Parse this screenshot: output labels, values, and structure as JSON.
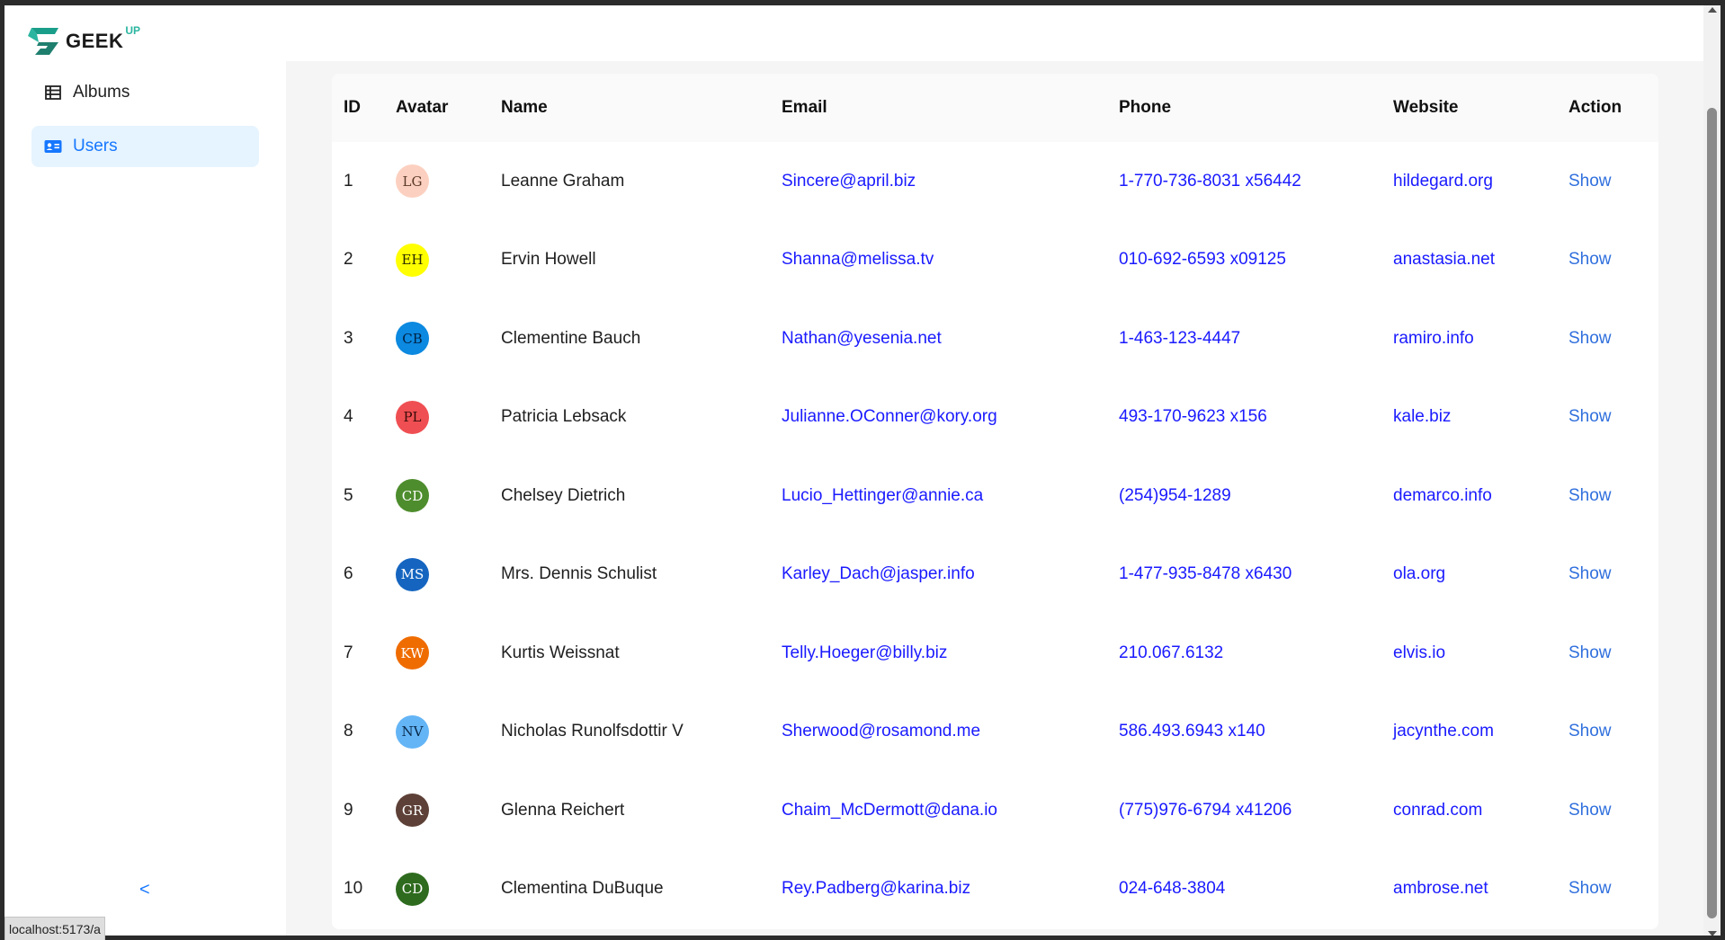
{
  "app": {
    "logo_text": "GEEK",
    "logo_sup": "UP"
  },
  "sidebar": {
    "items": [
      {
        "label": "Albums",
        "icon": "table-icon"
      },
      {
        "label": "Users",
        "icon": "id-card-icon"
      }
    ],
    "collapse_label": "<"
  },
  "table": {
    "headers": [
      "ID",
      "Avatar",
      "Name",
      "Email",
      "Phone",
      "Website",
      "Action"
    ],
    "rows": [
      {
        "id": "1",
        "initials": "LG",
        "avatar_color": "#fcd0c0",
        "avatar_text_color": "#5a3a2a",
        "name": "Leanne Graham",
        "email": "Sincere@april.biz",
        "phone": "1-770-736-8031 x56442",
        "website": "hildegard.org",
        "action": "Show"
      },
      {
        "id": "2",
        "initials": "EH",
        "avatar_color": "#ffff00",
        "avatar_text_color": "#2a2a00",
        "name": "Ervin Howell",
        "email": "Shanna@melissa.tv",
        "phone": "010-692-6593 x09125",
        "website": "anastasia.net",
        "action": "Show"
      },
      {
        "id": "3",
        "initials": "CB",
        "avatar_color": "#0c89e0",
        "avatar_text_color": "#002244",
        "name": "Clementine Bauch",
        "email": "Nathan@yesenia.net",
        "phone": "1-463-123-4447",
        "website": "ramiro.info",
        "action": "Show"
      },
      {
        "id": "4",
        "initials": "PL",
        "avatar_color": "#ef4f52",
        "avatar_text_color": "#3a0a0a",
        "name": "Patricia Lebsack",
        "email": "Julianne.OConner@kory.org",
        "phone": "493-170-9623 x156",
        "website": "kale.biz",
        "action": "Show"
      },
      {
        "id": "5",
        "initials": "CD",
        "avatar_color": "#4e8d2d",
        "avatar_text_color": "#ffffff",
        "name": "Chelsey Dietrich",
        "email": "Lucio_Hettinger@annie.ca",
        "phone": "(254)954-1289",
        "website": "demarco.info",
        "action": "Show"
      },
      {
        "id": "6",
        "initials": "MS",
        "avatar_color": "#1565c0",
        "avatar_text_color": "#ffffff",
        "name": "Mrs. Dennis Schulist",
        "email": "Karley_Dach@jasper.info",
        "phone": "1-477-935-8478 x6430",
        "website": "ola.org",
        "action": "Show"
      },
      {
        "id": "7",
        "initials": "KW",
        "avatar_color": "#ef6c00",
        "avatar_text_color": "#ffffff",
        "name": "Kurtis Weissnat",
        "email": "Telly.Hoeger@billy.biz",
        "phone": "210.067.6132",
        "website": "elvis.io",
        "action": "Show"
      },
      {
        "id": "8",
        "initials": "NV",
        "avatar_color": "#64b5f6",
        "avatar_text_color": "#0a2a4a",
        "name": "Nicholas Runolfsdottir V",
        "email": "Sherwood@rosamond.me",
        "phone": "586.493.6943 x140",
        "website": "jacynthe.com",
        "action": "Show"
      },
      {
        "id": "9",
        "initials": "GR",
        "avatar_color": "#5d4037",
        "avatar_text_color": "#ffffff",
        "name": "Glenna Reichert",
        "email": "Chaim_McDermott@dana.io",
        "phone": "(775)976-6794 x41206",
        "website": "conrad.com",
        "action": "Show"
      },
      {
        "id": "10",
        "initials": "CD",
        "avatar_color": "#2e6b1e",
        "avatar_text_color": "#ffffff",
        "name": "Clementina DuBuque",
        "email": "Rey.Padberg@karina.biz",
        "phone": "024-648-3804",
        "website": "ambrose.net",
        "action": "Show"
      }
    ]
  },
  "status_bar": {
    "url": "localhost:5173/a"
  }
}
